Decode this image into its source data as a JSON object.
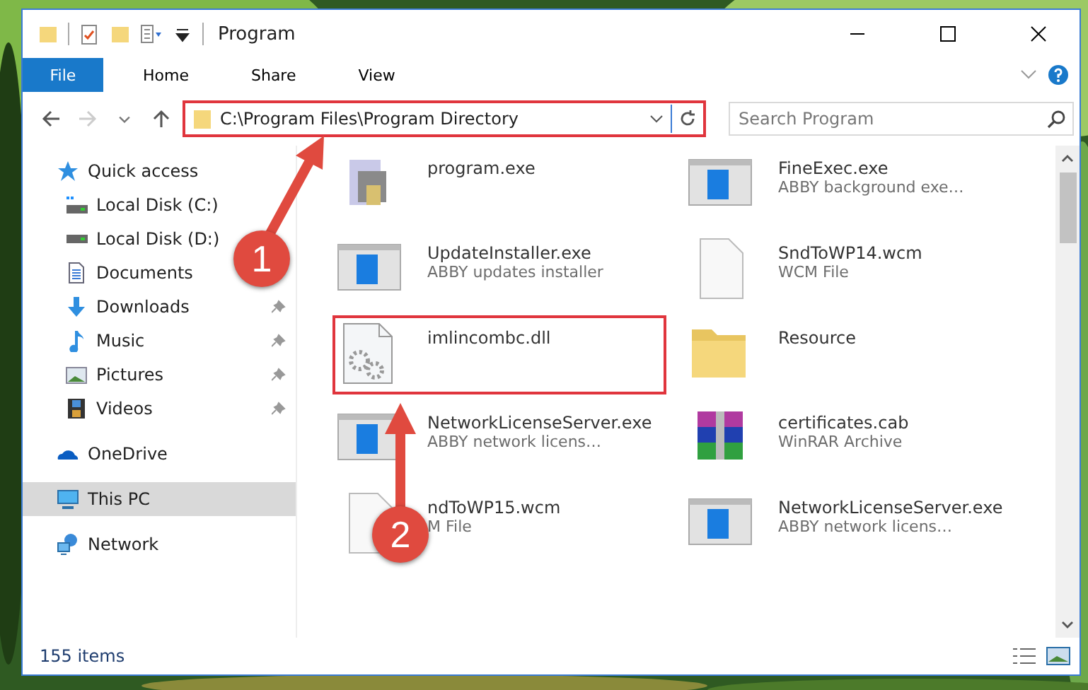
{
  "title_bar": {
    "title": "Program"
  },
  "ribbon": {
    "file_button": "File",
    "tabs": [
      {
        "label": "Home"
      },
      {
        "label": "Share"
      },
      {
        "label": "View"
      }
    ]
  },
  "address_bar": {
    "path": "C:\\Program Files\\Program Directory",
    "highlighted": true
  },
  "search": {
    "placeholder": "Search Program"
  },
  "navigation": [
    {
      "label": "Quick access",
      "kind": "star",
      "selected": false,
      "children": [
        {
          "label": "Local Disk (C:)",
          "kind": "system_drive"
        },
        {
          "label": "Local Disk (D:)",
          "kind": "drive"
        },
        {
          "label": "Documents",
          "kind": "documents"
        },
        {
          "label": "Downloads",
          "kind": "downloads",
          "pinned": true
        },
        {
          "label": "Music",
          "kind": "music",
          "pinned": true
        },
        {
          "label": "Pictures",
          "kind": "pictures",
          "pinned": true
        },
        {
          "label": "Videos",
          "kind": "videos",
          "pinned": true
        }
      ]
    },
    {
      "label": "OneDrive",
      "kind": "cloud",
      "selected": false
    },
    {
      "label": "This PC",
      "kind": "computer",
      "selected": true
    },
    {
      "label": "Network",
      "kind": "network",
      "selected": false
    }
  ],
  "files": [
    {
      "name": "program.exe",
      "kind": "installer",
      "highlighted": false
    },
    {
      "name": "FineExec.exe",
      "description": "ABBY background exe…",
      "kind": "app",
      "highlighted": false
    },
    {
      "name": "UpdateInstaller.exe",
      "description": "ABBY updates installer",
      "kind": "app",
      "highlighted": false
    },
    {
      "name": "SndToWP14.wcm",
      "description": "WCM File",
      "kind": "document",
      "highlighted": false
    },
    {
      "name": "imlincombc.dll",
      "kind": "dll",
      "highlighted": true
    },
    {
      "name": "Resource",
      "kind": "folder",
      "highlighted": false
    },
    {
      "name": "NetworkLicenseServer.exe",
      "description": "ABBY network licens…",
      "kind": "app",
      "highlighted": false
    },
    {
      "name": "certificates.cab",
      "description": "WinRAR Archive",
      "kind": "archive",
      "highlighted": false
    },
    {
      "name": "ndToWP15.wcm",
      "description": "M File",
      "kind": "document",
      "highlighted": false
    },
    {
      "name": "NetworkLicenseServer.exe",
      "description": "ABBY network licens…",
      "kind": "app",
      "highlighted": false
    }
  ],
  "status_bar": {
    "item_count": "155 items"
  },
  "annotations": [
    {
      "number": "1"
    },
    {
      "number": "2"
    }
  ]
}
